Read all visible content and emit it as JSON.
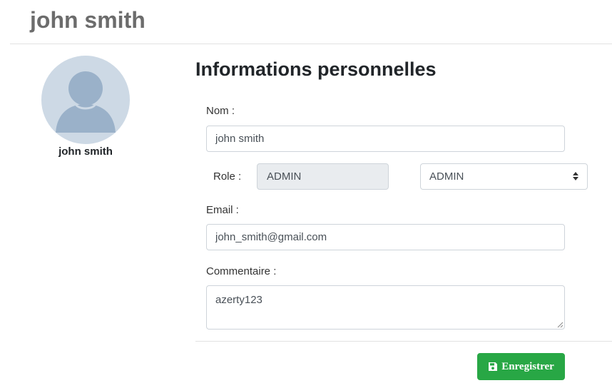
{
  "header": {
    "title": "john smith"
  },
  "profile": {
    "avatar_icon": "user-avatar-icon",
    "name": "john smith",
    "avatar_bg_color": "#cdd9e5",
    "avatar_fg_color": "#9ab1c9"
  },
  "form": {
    "section_title": "Informations personnelles",
    "nom": {
      "label": "Nom :",
      "value": "john smith"
    },
    "role": {
      "label": "Role :",
      "current_value": "ADMIN",
      "select_value": "ADMIN",
      "select_icon": "sort-arrows-icon"
    },
    "email": {
      "label": "Email :",
      "value": "john_smith@gmail.com"
    },
    "commentaire": {
      "label": "Commentaire :",
      "value": "azerty123"
    },
    "save_button": {
      "label": "Enregistrer",
      "icon": "floppy-disk-icon",
      "color": "#28a745"
    }
  }
}
